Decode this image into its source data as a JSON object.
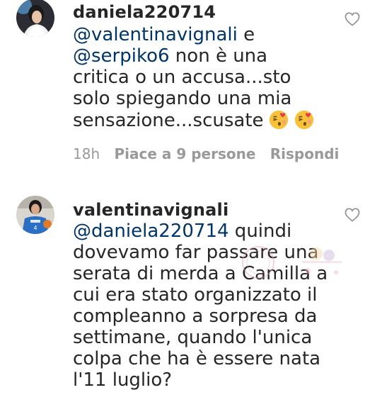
{
  "comments": [
    {
      "username": "daniela220714",
      "lines": [
        {
          "mention": "@valentinavignali",
          "text": " e"
        },
        {
          "mention": "@serpiko6",
          "text": " non è una"
        },
        {
          "mention": "",
          "text": "critica o un accusa...sto"
        },
        {
          "mention": "",
          "text": "solo spiegando una mia"
        },
        {
          "mention": "",
          "text": "sensazione...scusate"
        }
      ],
      "emojis": [
        "kissing-face-with-heart-emoji",
        "kissing-face-with-heart-emoji"
      ],
      "time": "18h",
      "likes_label": "Piace a 9 persone",
      "reply_label": "Rispondi",
      "avatar_icon": "profile-photo"
    },
    {
      "username": "valentinavignali",
      "lines": [
        {
          "mention": "@daniela220714",
          "text": " quindi"
        },
        {
          "mention": "",
          "text": "dovevamo far passare una"
        },
        {
          "mention": "",
          "text": "serata di merda a Camilla a"
        },
        {
          "mention": "",
          "text": "cui era stato organizzato il"
        },
        {
          "mention": "",
          "text": "compleanno a sorpresa da"
        },
        {
          "mention": "",
          "text": "settimane, quando l'unica"
        },
        {
          "mention": "",
          "text": "colpa che ha è essere nata"
        },
        {
          "mention": "",
          "text": "l'11 luglio?"
        }
      ],
      "avatar_icon": "profile-photo"
    }
  ],
  "colors": {
    "text": "#262626",
    "mention": "#003569",
    "meta": "#999999",
    "heart_outline": "#8e8e8e"
  }
}
